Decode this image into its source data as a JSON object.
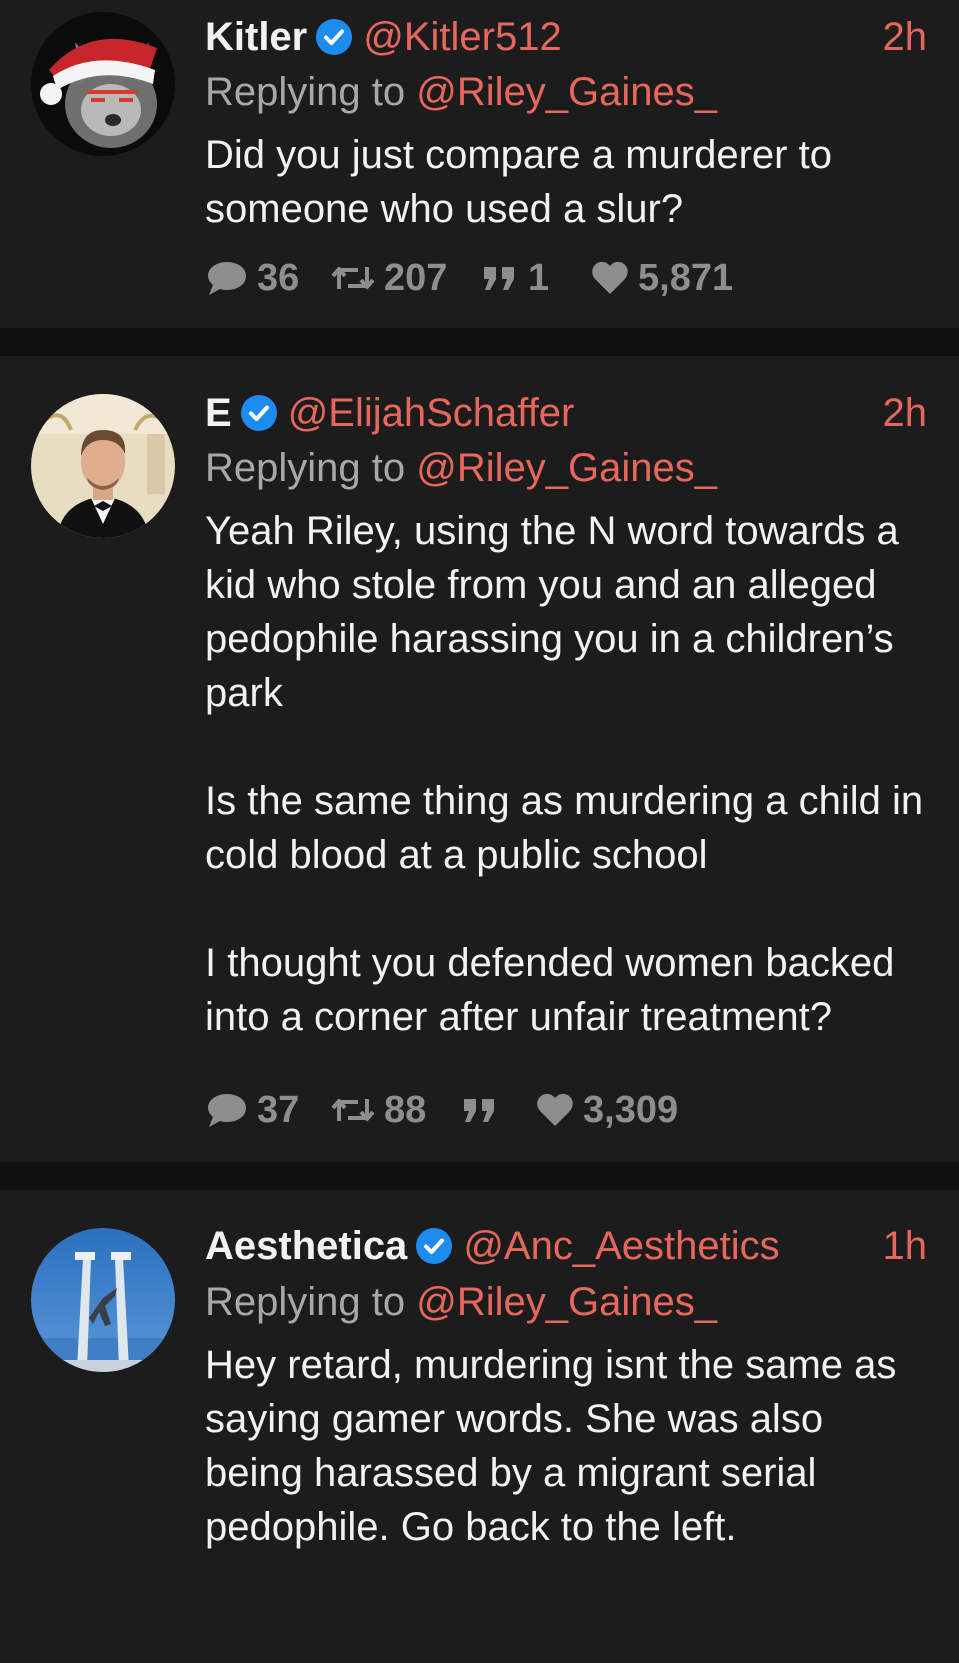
{
  "colors": {
    "background": "#0f0f0f",
    "card": "#1c1c1c",
    "accent": "#e8675c",
    "muted": "#a8a8a8",
    "metric": "#8e8e8e",
    "verified": "#1d8cf0"
  },
  "reply_prefix": "Replying to",
  "tweets": [
    {
      "display_name": "Kitler",
      "handle": "@Kitler512",
      "time": "2h",
      "verified": true,
      "replying_to": "@Riley_Gaines_",
      "body": [
        "Did you just compare a murderer to someone who used a slur?"
      ],
      "metrics": {
        "replies": "36",
        "retweets": "207",
        "quotes": "1",
        "likes": "5,871"
      },
      "avatar_icon": "cat-santa-hat-avatar"
    },
    {
      "display_name": "E",
      "handle": "@ElijahSchaffer",
      "time": "2h",
      "verified": true,
      "replying_to": "@Riley_Gaines_",
      "body": [
        "Yeah Riley, using the N word towards a kid who stole from you and an alleged pedophile harassing you in a children’s park",
        "Is the same thing as murdering a child in cold blood at a public school",
        "I thought you defended women backed into a corner after unfair treatment?"
      ],
      "metrics": {
        "replies": "37",
        "retweets": "88",
        "quotes": "",
        "likes": "3,309"
      },
      "avatar_icon": "man-in-tuxedo-avatar"
    },
    {
      "display_name": "Aesthetica",
      "handle": "@Anc_Aesthetics",
      "time": "1h",
      "verified": true,
      "replying_to": "@Riley_Gaines_",
      "body": [
        "Hey retard, murdering isnt the same as saying gamer words. She was also being harassed by a migrant serial pedophile. Go back to the left."
      ],
      "avatar_icon": "monument-sculpture-avatar"
    }
  ]
}
